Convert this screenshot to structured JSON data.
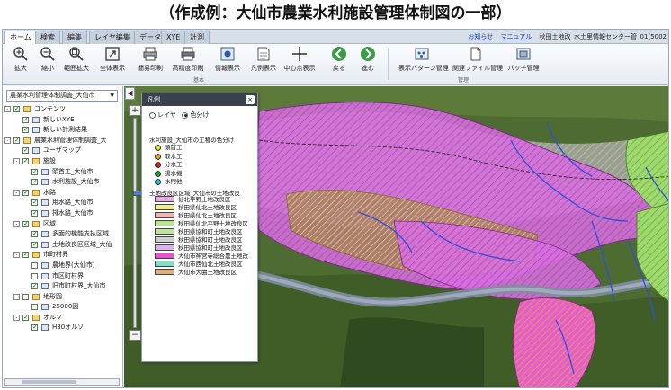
{
  "caption": "（作成例：大仙市農業水利施設管理体制図の一部）",
  "tabs": [
    {
      "label": "ホーム"
    },
    {
      "label": "検索"
    },
    {
      "label": "編集"
    },
    {
      "label": "レイヤ編集"
    },
    {
      "label": "データ"
    },
    {
      "label": "XYE"
    },
    {
      "label": "計測"
    }
  ],
  "top_links": {
    "notice": "お知らせ",
    "manual": "マニュアル",
    "user": "秋田土地改_水土里情報センター管_01(5002"
  },
  "toolbar": {
    "tools": [
      {
        "label": "拡大",
        "icon": "zoom-in-icon"
      },
      {
        "label": "縮小",
        "icon": "zoom-out-icon"
      },
      {
        "label": "範囲拡大",
        "icon": "zoom-area-icon"
      },
      {
        "label": "全体表示",
        "icon": "full-extent-icon"
      },
      {
        "label": "簡易印刷",
        "icon": "printer-icon"
      },
      {
        "label": "高精度印刷",
        "icon": "printer-hq-icon"
      },
      {
        "label": "情報表示",
        "icon": "info-icon"
      },
      {
        "label": "凡例表示",
        "icon": "legend-icon"
      },
      {
        "label": "中心点表示",
        "icon": "crosshair-icon"
      },
      {
        "label": "戻る",
        "icon": "back-arrow-icon"
      },
      {
        "label": "進む",
        "icon": "forward-arrow-icon"
      },
      {
        "label": "表示パターン管理",
        "icon": "pattern-icon"
      },
      {
        "label": "関連ファイル管理",
        "icon": "file-icon"
      },
      {
        "label": "パッチ管理",
        "icon": "patch-icon"
      }
    ],
    "group_basic": "基本",
    "group_manage": "管理"
  },
  "left_panel": {
    "select_value": "農業水利管理体制調査_大仙市",
    "tree": [
      {
        "label": "コンテンツ",
        "level": 0,
        "expander": "-",
        "checked": true,
        "icon": "folder"
      },
      {
        "label": "新しいXYE",
        "level": 1,
        "expander": "",
        "checked": true,
        "icon": "pencil"
      },
      {
        "label": "新しい計測結果",
        "level": 1,
        "expander": "",
        "checked": true,
        "icon": "layer"
      },
      {
        "label": "農業水利管理体制調査_大",
        "level": 0,
        "expander": "-",
        "checked": true,
        "icon": "folder"
      },
      {
        "label": "ユーザマップ",
        "level": 1,
        "expander": "",
        "checked": true,
        "icon": "layer"
      },
      {
        "label": "施設",
        "level": 1,
        "expander": "-",
        "checked": true,
        "icon": "folder"
      },
      {
        "label": "頭首工_大仙市",
        "level": 2,
        "expander": "",
        "checked": true,
        "icon": "layer"
      },
      {
        "label": "水利施設_大仙市",
        "level": 2,
        "expander": "",
        "checked": true,
        "icon": "layer"
      },
      {
        "label": "水路",
        "level": 1,
        "expander": "-",
        "checked": true,
        "icon": "folder"
      },
      {
        "label": "用水路_大仙市",
        "level": 2,
        "expander": "",
        "checked": true,
        "icon": "layer"
      },
      {
        "label": "排水路_大仙市",
        "level": 2,
        "expander": "",
        "checked": true,
        "icon": "layer"
      },
      {
        "label": "区域",
        "level": 1,
        "expander": "-",
        "checked": true,
        "icon": "folder"
      },
      {
        "label": "多面的機能支払区域",
        "level": 2,
        "expander": "",
        "checked": true,
        "icon": "layer"
      },
      {
        "label": "土地改良区区域_大仙",
        "level": 2,
        "expander": "",
        "checked": true,
        "icon": "layer"
      },
      {
        "label": "市町村界",
        "level": 1,
        "expander": "-",
        "checked": true,
        "icon": "folder"
      },
      {
        "label": "農地界(大仙市)",
        "level": 2,
        "expander": "",
        "checked": false,
        "icon": "layer"
      },
      {
        "label": "市区町村界",
        "level": 2,
        "expander": "",
        "checked": false,
        "icon": "layer"
      },
      {
        "label": "旧市町村界_大仙市",
        "level": 2,
        "expander": "",
        "checked": true,
        "icon": "layer"
      },
      {
        "label": "地形図",
        "level": 1,
        "expander": "-",
        "checked": false,
        "icon": "folder"
      },
      {
        "label": "25000図",
        "level": 2,
        "expander": "",
        "checked": false,
        "icon": "layer"
      },
      {
        "label": "オルソ",
        "level": 1,
        "expander": "-",
        "checked": true,
        "icon": "folder"
      },
      {
        "label": "H30オルソ",
        "level": 2,
        "expander": "",
        "checked": true,
        "icon": "layer"
      }
    ]
  },
  "legend": {
    "title": "凡例",
    "close": "×",
    "radio_layer": "レイヤ",
    "radio_color": "色分け",
    "section1": "水利施設_大仙市の工種の色分け",
    "facility_types": [
      {
        "label": "頭首工",
        "color": "#f2e437"
      },
      {
        "label": "取水工",
        "color": "#f09a1f"
      },
      {
        "label": "分水工",
        "color": "#c8281e"
      },
      {
        "label": "揚水機",
        "color": "#2f9a3a"
      },
      {
        "label": "水門他",
        "color": "#2dbde0"
      }
    ],
    "section2": "土地改良区区域_大仙市の土地改良",
    "districts": [
      {
        "label": "仙北平野土地改良区",
        "color": "#e9a9e6"
      },
      {
        "label": "秋田県仙北土地改良区",
        "color": "#f3ec8a"
      },
      {
        "label": "秋田県仙北土地改良区",
        "color": "#f3b3b3"
      },
      {
        "label": "秋田県仙北平野土地改良区",
        "color": "#b9e58f"
      },
      {
        "label": "秋田県協和町土地改良区",
        "color": "#bfe59c"
      },
      {
        "label": "秋田県協和町土地改良区",
        "color": "#cfcfcf"
      },
      {
        "label": "秋田県協和町土地改良区",
        "color": "#d9b3f0"
      },
      {
        "label": "大仙市神宮寺総合農土地改",
        "color": "#e94fd9"
      },
      {
        "label": "大仙市西仙北土地改良区",
        "color": "#7fe0c8"
      },
      {
        "label": "大仙市大曲土地改良区",
        "color": "#e0b07a"
      }
    ]
  }
}
